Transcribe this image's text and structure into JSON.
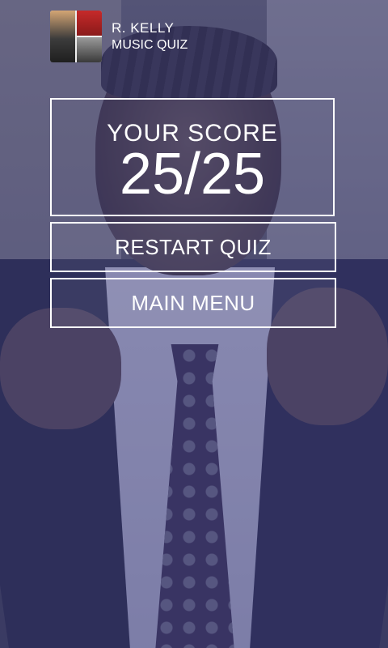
{
  "header": {
    "title": "R. KELLY",
    "subtitle": "MUSIC QUIZ",
    "thumbnail_icon": "artist-collage-icon"
  },
  "score": {
    "label": "YOUR SCORE",
    "value": "25/25"
  },
  "buttons": {
    "restart_label": "RESTART QUIZ",
    "main_menu_label": "MAIN MENU"
  },
  "colors": {
    "overlay_tint": "#3a3a78",
    "text": "#ffffff",
    "border": "#ffffff"
  }
}
